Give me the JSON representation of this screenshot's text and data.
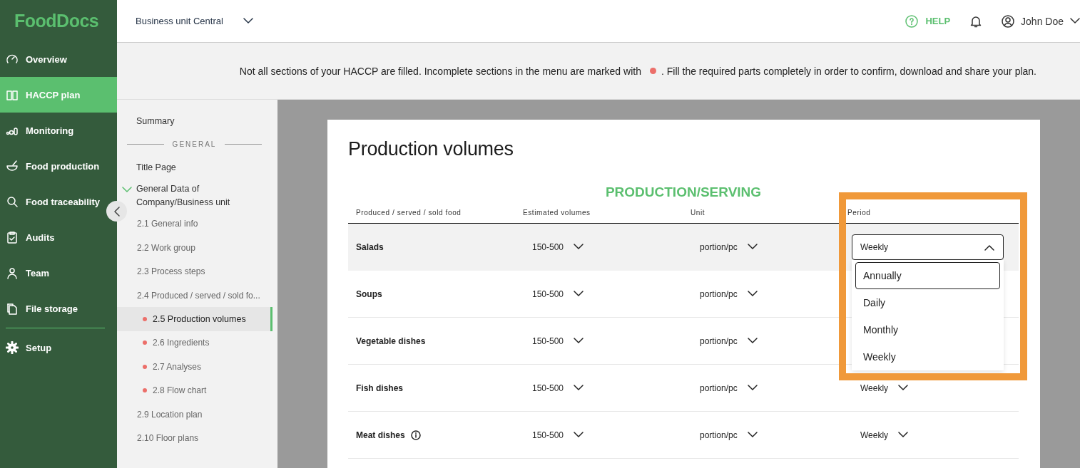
{
  "logo": "FoodDocs",
  "topbar": {
    "business_unit": "Business unit Central",
    "help": "HELP",
    "user": "John Doe"
  },
  "nav": [
    {
      "kind": "gauge",
      "label": "Overview",
      "selected": false
    },
    {
      "kind": "book",
      "label": "HACCP plan",
      "selected": true
    },
    {
      "kind": "bars",
      "label": "Monitoring",
      "selected": false
    },
    {
      "kind": "bowl",
      "label": "Food production",
      "selected": false
    },
    {
      "kind": "search",
      "label": "Food traceability",
      "selected": false
    },
    {
      "kind": "clipboard",
      "label": "Audits",
      "selected": false
    },
    {
      "kind": "person",
      "label": "Team",
      "selected": false
    },
    {
      "kind": "files",
      "label": "File storage",
      "selected": false
    },
    {
      "kind": "gear",
      "label": "Setup",
      "selected": false
    }
  ],
  "banner": {
    "before": "Not all sections of your HACCP are filled. Incomplete sections in the menu are marked with",
    "after": ". Fill the required parts completely in order to confirm, download and share your plan."
  },
  "subnav": [
    {
      "kind": "link",
      "label": "Summary",
      "selected": false,
      "incomplete": false
    },
    {
      "kind": "heading",
      "label": "GENERAL"
    },
    {
      "kind": "link",
      "label": "Title Page",
      "selected": false,
      "incomplete": false
    },
    {
      "kind": "group",
      "label": "General Data of Company/Business unit",
      "expanded": true,
      "children": [
        {
          "label": "2.1 General info",
          "selected": false,
          "incomplete": false
        },
        {
          "label": "2.2 Work group",
          "selected": false,
          "incomplete": false
        },
        {
          "label": "2.3 Process steps",
          "selected": false,
          "incomplete": false
        },
        {
          "label": "2.4 Produced / served / sold fo...",
          "selected": false,
          "incomplete": false
        },
        {
          "label": "2.5 Production volumes",
          "selected": true,
          "incomplete": true
        },
        {
          "label": "2.6 Ingredients",
          "selected": false,
          "incomplete": true
        },
        {
          "label": "2.7 Analyses",
          "selected": false,
          "incomplete": true
        },
        {
          "label": "2.8 Flow chart",
          "selected": false,
          "incomplete": true
        },
        {
          "label": "2.9 Location plan",
          "selected": false,
          "incomplete": false
        },
        {
          "label": "2.10 Floor plans",
          "selected": false,
          "incomplete": false
        }
      ]
    }
  ],
  "page": {
    "title": "Production volumes",
    "section": "PRODUCTION/SERVING",
    "columns": [
      "Produced / served / sold food",
      "Estimated volumes",
      "Unit",
      "Period"
    ],
    "rows": [
      {
        "name": "Salads",
        "info": false,
        "volume": "150-500",
        "unit": "portion/pc",
        "period": "Weekly",
        "open": true
      },
      {
        "name": "Soups",
        "info": false,
        "volume": "150-500",
        "unit": "portion/pc",
        "open": false
      },
      {
        "name": "Vegetable dishes",
        "info": false,
        "volume": "150-500",
        "unit": "portion/pc",
        "open": false
      },
      {
        "name": "Fish dishes",
        "info": false,
        "volume": "150-500",
        "unit": "portion/pc",
        "period": "Weekly",
        "open": false
      },
      {
        "name": "Meat dishes",
        "info": true,
        "volume": "150-500",
        "unit": "portion/pc",
        "period": "Weekly",
        "open": false
      }
    ],
    "period_options": [
      {
        "label": "Annually",
        "highlighted": true
      },
      {
        "label": "Daily",
        "highlighted": false
      },
      {
        "label": "Monthly",
        "highlighted": false
      },
      {
        "label": "Weekly",
        "highlighted": false
      }
    ]
  },
  "annotation": {
    "highlight_frame": true
  }
}
